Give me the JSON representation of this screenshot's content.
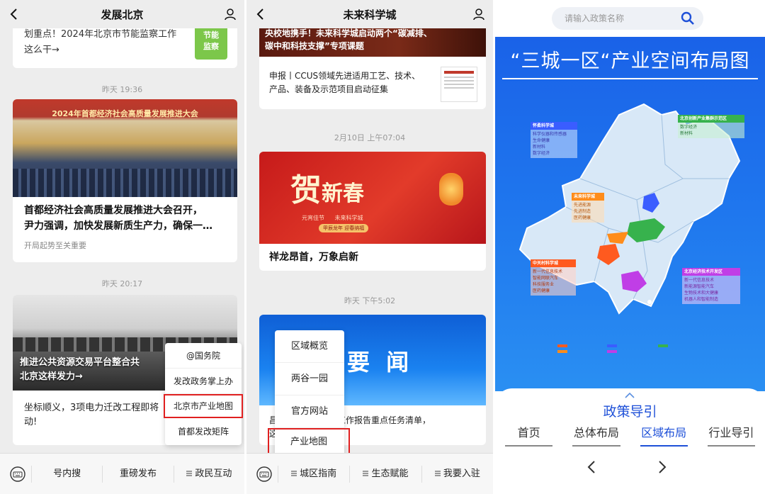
{
  "panel1": {
    "title": "发展北京",
    "top_snippet": {
      "title_line1": "划重点！2024年北京市节能监察工作",
      "title_line2": "这么干→",
      "badge_line1": "节能",
      "badge_line2": "监察"
    },
    "time1": "昨天 19:36",
    "article1": {
      "banner_text": "2024年首都经济社会高质量发展推进大会",
      "title_line1": "首都经济社会高质量发展推进大会召开，",
      "title_line2": "尹力强调，加快发展新质生产力，确保一…",
      "sub": "开局起势至关重要"
    },
    "time2": "昨天 20:17",
    "article2": {
      "overlay_line1": "推进公共资源交易平台整合共",
      "overlay_line2": "北京这样发力→",
      "title_line1": "坐标顺义，3项电力迁改工程即将",
      "title_line2": "动!"
    },
    "popup": [
      "@国务院",
      "发改政务掌上办",
      "北京市产业地图",
      "首都发改矩阵"
    ],
    "popup_highlight_index": 2,
    "bottom_bar": [
      "号内搜",
      "重磅发布",
      "政民互动"
    ]
  },
  "panel2": {
    "title": "未来科学城",
    "top_banner": {
      "line1": "央校地携手！未来科学城启动两个“碳减排、",
      "line2": "碳中和科技支撑”专项课题"
    },
    "article0": {
      "title_line1": "申报丨CCUS领域先进适用工艺、技术、",
      "title_line2": "产品、装备及示范项目启动征集"
    },
    "time1": "2月10日 上午07:04",
    "article1": {
      "banner_char1": "贺",
      "banner_rest": "新春",
      "banner_small1": "元宵佳节",
      "banner_small2": "未来科学城",
      "banner_pill": "甲辰龙年 迎春纳福",
      "title": "祥龙昂首，万象启新"
    },
    "time2": "昨天 下午5:02",
    "article2": {
      "banner_text": "要 闻",
      "title_line1": "昌　　　　　　府工作报告重点任务清单，",
      "title_line2": "这　　　　　　城→"
    },
    "popup": [
      "区域概览",
      "两谷一园",
      "官方网站",
      "产业地图"
    ],
    "popup_highlight_index": 3,
    "bottom_bar": [
      "城区指南",
      "生态赋能",
      "我要入驻"
    ]
  },
  "panel3": {
    "search": {
      "placeholder": "请输入政策名称"
    },
    "map_title": "“三城一区“产业空间布局图",
    "regions": [
      {
        "name": "怀柔科学城",
        "items": [
          "科学仪器和传感器",
          "生命健康",
          "新材料",
          "数字经济"
        ]
      },
      {
        "name": "北京创新产业集群示范区",
        "items": [
          "数字经济",
          "新材料"
        ]
      },
      {
        "name": "未来科学城",
        "items": [
          "先进能源",
          "先进制造",
          "医药健康"
        ]
      },
      {
        "name": "中关村科学城",
        "items": [
          "新一代信息技术",
          "智能网联汽车",
          "科技服务业",
          "医药健康"
        ]
      },
      {
        "name": "北京经济技术开发区",
        "items": [
          "新一代信息技术",
          "新能源智能汽车",
          "生物技术和大健康",
          "机器人和智能制造"
        ]
      }
    ],
    "region_colors": [
      "#3a5dff",
      "#37b24d",
      "#ff8c1a",
      "#ff5a1f",
      "#c03ee6"
    ],
    "guide_title": "政策导引",
    "tabs": [
      "首页",
      "总体布局",
      "区域布局",
      "行业导引"
    ],
    "active_tab_index": 2
  }
}
